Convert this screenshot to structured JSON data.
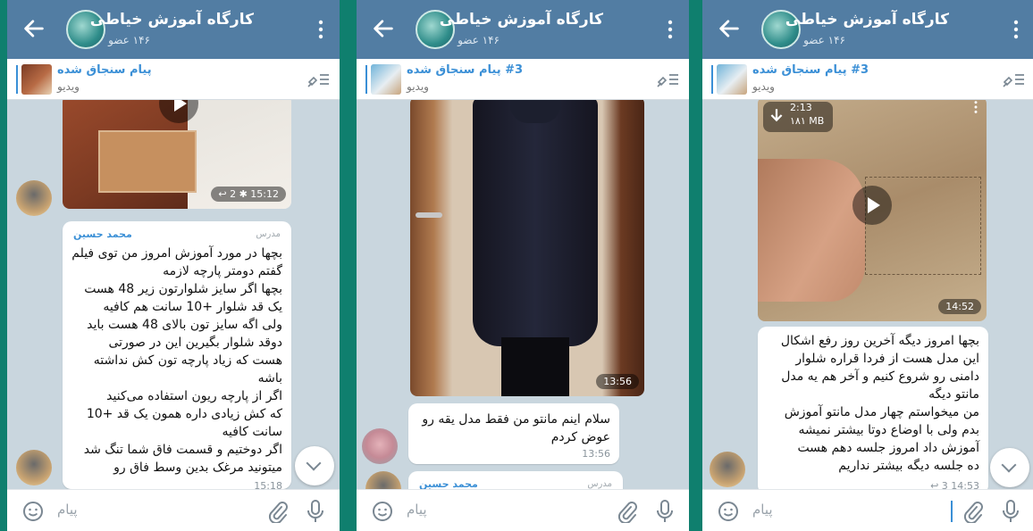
{
  "colors": {
    "header": "#527da3",
    "accent": "#3a8fd6",
    "chat_bg": "#c9d6de",
    "outer_bg": "#0f7f6e"
  },
  "channel": {
    "title": "کارگاه آموزش خیاطی",
    "members": "۱۴۶ عضو"
  },
  "input": {
    "placeholder": "پیام"
  },
  "icons": {
    "back": "arrow-left-icon",
    "menu": "kebab-icon",
    "pin": "pin-list-icon",
    "emoji": "emoji-icon",
    "attach": "paperclip-icon",
    "mic": "microphone-icon",
    "scroll": "chevron-down-icon"
  },
  "panel1": {
    "pinned_title": "پیام سنجاق شده",
    "pinned_sub": "ویدیو",
    "video_meta": {
      "replies": "2",
      "time": "15:12"
    },
    "msg_sender": "محمد حسین",
    "msg_role": "مدرس",
    "msg_lines": [
      "بچها در مورد آموزش امروز من توی فیلم",
      "گفتم دومتر پارچه لازمه",
      "بچها اگر سایز شلوارتون زیر 48 هست",
      "یک قد شلوار +10 سانت هم کافیه",
      "ولی اگه سایز تون بالای 48 هست باید",
      "دوقد شلوار بگیرین  این در صورتی",
      "هست که زیاد پارچه تون کش نداشته",
      "باشه",
      "اگر از پارچه ریون استفاده می‌کنید",
      "که کش زیادی داره همون یک قد +10",
      "سانت کافیه",
      "اگر دوختیم و قسمت فاق شما تنگ شد",
      "میتونید مرغک بدین وسط فاق رو"
    ],
    "msg_time": "15:18"
  },
  "panel2": {
    "pinned_title": "#3 پیام سنجاق شده",
    "pinned_sub": "ویدیو",
    "photo_time": "13:56",
    "msg_lines": [
      "سلام اینم مانتو من فقط مدل یقه رو",
      "عوض کردم"
    ],
    "msg_time": "13:56",
    "next_sender": "محمد حسین",
    "next_role": "مدرس"
  },
  "panel3": {
    "pinned_title": "#3 پیام سنجاق شده",
    "pinned_sub": "ویدیو",
    "video_duration": "2:13",
    "video_size": "۱۸۱ MB",
    "video_time": "14:52",
    "msg_lines": [
      "بچها امروز دیگه آخرین روز رفع اشکال",
      "این مدل هست از فردا قراره شلوار",
      "دامنی رو شروع کنیم و آخر هم یه مدل",
      "مانتو دیگه",
      "من میخواستم چهار مدل مانتو آموزش",
      "بدم ولی با اوضاع دوتا بیشتر نمیشه",
      "آموزش داد امروز جلسه دهم هست",
      "ده جلسه دیگه بیشتر نداریم"
    ],
    "msg_replies": "3",
    "msg_time": "14:53"
  }
}
